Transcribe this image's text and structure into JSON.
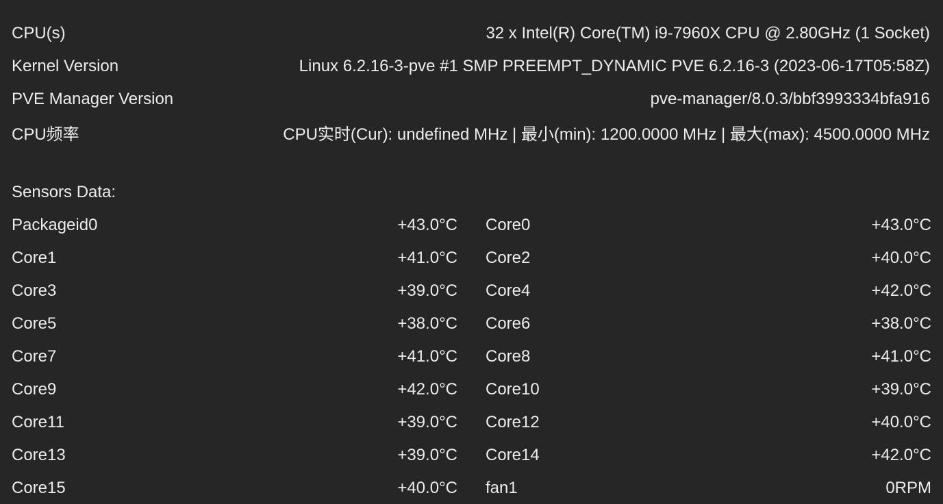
{
  "node_info": [
    {
      "label": "CPU(s)",
      "value": "32 x Intel(R) Core(TM) i9-7960X CPU @ 2.80GHz (1 Socket)"
    },
    {
      "label": "Kernel Version",
      "value": "Linux 6.2.16-3-pve #1 SMP PREEMPT_DYNAMIC PVE 6.2.16-3 (2023-06-17T05:58Z)"
    },
    {
      "label": "PVE Manager Version",
      "value": "pve-manager/8.0.3/bbf3993334bfa916"
    },
    {
      "label": "CPU频率",
      "value": "CPU实时(Cur): undefined MHz | 最小(min): 1200.0000 MHz | 最大(max): 4500.0000 MHz"
    }
  ],
  "sensors": {
    "title": "Sensors Data:",
    "rows": [
      {
        "left": {
          "name": "Packageid0",
          "value": "+43.0°C"
        },
        "right": {
          "name": "Core0",
          "value": "+43.0°C"
        }
      },
      {
        "left": {
          "name": "Core1",
          "value": "+41.0°C"
        },
        "right": {
          "name": "Core2",
          "value": "+40.0°C"
        }
      },
      {
        "left": {
          "name": "Core3",
          "value": "+39.0°C"
        },
        "right": {
          "name": "Core4",
          "value": "+42.0°C"
        }
      },
      {
        "left": {
          "name": "Core5",
          "value": "+38.0°C"
        },
        "right": {
          "name": "Core6",
          "value": "+38.0°C"
        }
      },
      {
        "left": {
          "name": "Core7",
          "value": "+41.0°C"
        },
        "right": {
          "name": "Core8",
          "value": "+41.0°C"
        }
      },
      {
        "left": {
          "name": "Core9",
          "value": "+42.0°C"
        },
        "right": {
          "name": "Core10",
          "value": "+39.0°C"
        }
      },
      {
        "left": {
          "name": "Core11",
          "value": "+39.0°C"
        },
        "right": {
          "name": "Core12",
          "value": "+40.0°C"
        }
      },
      {
        "left": {
          "name": "Core13",
          "value": "+39.0°C"
        },
        "right": {
          "name": "Core14",
          "value": "+42.0°C"
        }
      },
      {
        "left": {
          "name": "Core15",
          "value": "+40.0°C"
        },
        "right": {
          "name": "fan1",
          "value": "0RPM"
        }
      }
    ]
  }
}
